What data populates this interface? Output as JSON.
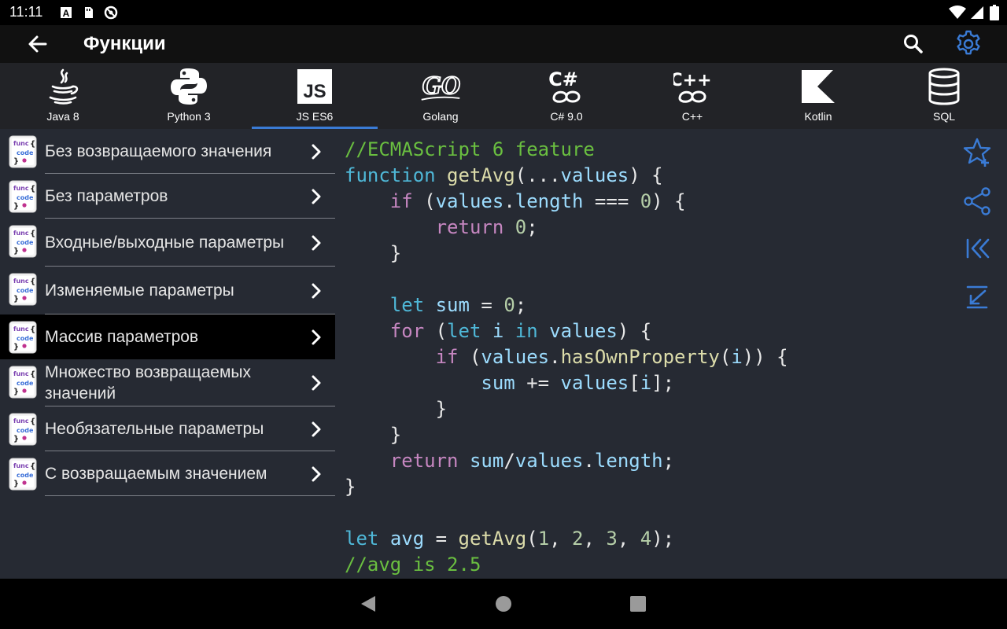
{
  "status": {
    "time": "11:11"
  },
  "appbar": {
    "title": "Функции"
  },
  "languages": [
    {
      "label": "Java 8",
      "icon": "java-icon",
      "active": false
    },
    {
      "label": "Python 3",
      "icon": "python-icon",
      "active": false
    },
    {
      "label": "JS ES6",
      "icon": "javascript-icon",
      "active": true
    },
    {
      "label": "Golang",
      "icon": "golang-icon",
      "active": false
    },
    {
      "label": "C# 9.0",
      "icon": "csharp-icon",
      "active": false
    },
    {
      "label": "C++",
      "icon": "cpp-icon",
      "active": false
    },
    {
      "label": "Kotlin",
      "icon": "kotlin-icon",
      "active": false
    },
    {
      "label": "SQL",
      "icon": "database-icon",
      "active": false
    }
  ],
  "sidebar": {
    "icon_text": {
      "top": "func",
      "mid": "code",
      "brace_open": "{",
      "brace_close": "}"
    },
    "items": [
      {
        "label": "Без возвращаемого значения",
        "active": false
      },
      {
        "label": "Без параметров",
        "active": false
      },
      {
        "label": "Входные/выходные параметры",
        "active": false
      },
      {
        "label": "Изменяемые параметры",
        "active": false
      },
      {
        "label": "Массив параметров",
        "active": true
      },
      {
        "label": "Множество возвращаемых значений",
        "active": false
      },
      {
        "label": "Необязательные параметры",
        "active": false
      },
      {
        "label": "С возвращаемым значением",
        "active": false
      }
    ]
  },
  "code": {
    "lines": [
      [
        [
          "c",
          "//ECMAScript 6 feature"
        ]
      ],
      [
        [
          "d",
          "function"
        ],
        [
          "",
          " "
        ],
        [
          "f",
          "getAvg"
        ],
        [
          "",
          "(..."
        ],
        [
          "v",
          "values"
        ],
        [
          "",
          ") {"
        ]
      ],
      [
        [
          "",
          "    "
        ],
        [
          "k",
          "if"
        ],
        [
          "",
          " ("
        ],
        [
          "v",
          "values"
        ],
        [
          "",
          "."
        ],
        [
          "v",
          "length"
        ],
        [
          "",
          " === "
        ],
        [
          "n",
          "0"
        ],
        [
          "",
          ") {"
        ]
      ],
      [
        [
          "",
          "        "
        ],
        [
          "k",
          "return"
        ],
        [
          "",
          " "
        ],
        [
          "n",
          "0"
        ],
        [
          "",
          ";"
        ]
      ],
      [
        [
          "",
          "    }"
        ]
      ],
      [
        [
          "",
          ""
        ]
      ],
      [
        [
          "",
          "    "
        ],
        [
          "d",
          "let"
        ],
        [
          "",
          " "
        ],
        [
          "v",
          "sum"
        ],
        [
          "",
          " = "
        ],
        [
          "n",
          "0"
        ],
        [
          "",
          ";"
        ]
      ],
      [
        [
          "",
          "    "
        ],
        [
          "k",
          "for"
        ],
        [
          "",
          " ("
        ],
        [
          "d",
          "let"
        ],
        [
          "",
          " "
        ],
        [
          "v",
          "i"
        ],
        [
          "",
          " "
        ],
        [
          "d",
          "in"
        ],
        [
          "",
          " "
        ],
        [
          "v",
          "values"
        ],
        [
          "",
          ") {"
        ]
      ],
      [
        [
          "",
          "        "
        ],
        [
          "k",
          "if"
        ],
        [
          "",
          " ("
        ],
        [
          "v",
          "values"
        ],
        [
          "",
          "."
        ],
        [
          "f",
          "hasOwnProperty"
        ],
        [
          "",
          "("
        ],
        [
          "v",
          "i"
        ],
        [
          "",
          ")) {"
        ]
      ],
      [
        [
          "",
          "            "
        ],
        [
          "v",
          "sum"
        ],
        [
          "",
          " += "
        ],
        [
          "v",
          "values"
        ],
        [
          "",
          "["
        ],
        [
          "v",
          "i"
        ],
        [
          "",
          "];"
        ]
      ],
      [
        [
          "",
          "        }"
        ]
      ],
      [
        [
          "",
          "    }"
        ]
      ],
      [
        [
          "",
          "    "
        ],
        [
          "k",
          "return"
        ],
        [
          "",
          " "
        ],
        [
          "v",
          "sum"
        ],
        [
          "",
          "/"
        ],
        [
          "v",
          "values"
        ],
        [
          "",
          "."
        ],
        [
          "v",
          "length"
        ],
        [
          "",
          ";"
        ]
      ],
      [
        [
          "",
          "}"
        ]
      ],
      [
        [
          "",
          ""
        ]
      ],
      [
        [
          "d",
          "let"
        ],
        [
          "",
          " "
        ],
        [
          "v",
          "avg"
        ],
        [
          "",
          " = "
        ],
        [
          "f",
          "getAvg"
        ],
        [
          "",
          "("
        ],
        [
          "n",
          "1"
        ],
        [
          "",
          ", "
        ],
        [
          "n",
          "2"
        ],
        [
          "",
          ", "
        ],
        [
          "n",
          "3"
        ],
        [
          "",
          ", "
        ],
        [
          "n",
          "4"
        ],
        [
          "",
          ");"
        ]
      ],
      [
        [
          "c",
          "//avg is 2.5"
        ]
      ]
    ]
  },
  "colors": {
    "accent": "#3a7bd5",
    "panel": "#262a33",
    "tabbar": "#222327"
  }
}
